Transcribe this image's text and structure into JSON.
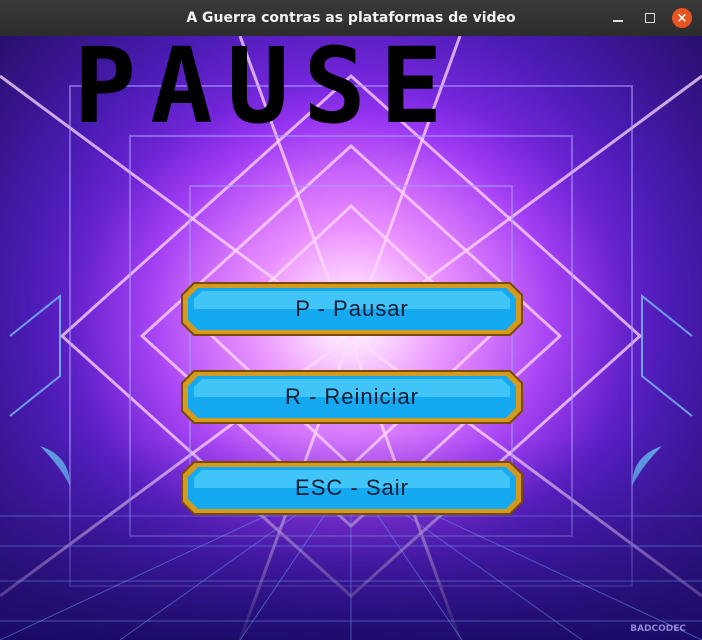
{
  "window": {
    "title": "A Guerra contras as plataformas de video"
  },
  "screen": {
    "heading": "PAUSE",
    "buttons": {
      "pause": "P - Pausar",
      "restart": "R - Reiniciar",
      "exit": "ESC - Sair"
    },
    "watermark": "BADCODEC"
  },
  "colors": {
    "titlebar": "#2c2c2c",
    "close": "#e95420",
    "heading": "#000000",
    "button_fill": "#1fb6ff",
    "button_frame": "#c98a14",
    "background_glow": "#ff9cff"
  }
}
